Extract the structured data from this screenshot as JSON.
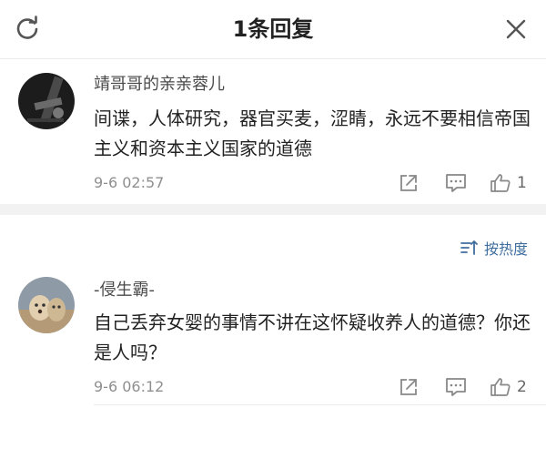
{
  "header": {
    "title": "1条回复",
    "refresh_icon": "refresh-icon",
    "close_icon": "close-icon"
  },
  "sort": {
    "label": "按热度",
    "icon": "sort-icon"
  },
  "comments": [
    {
      "username": "靖哥哥的亲亲蓉儿",
      "text": "间谍，人体研究，器官买麦，涩睛，永远不要相信帝国主义和资本主义国家的道德",
      "time": "9-6 02:57",
      "likes": "1"
    },
    {
      "username": "-侵生霸-",
      "text": "自己丢弃女婴的事情不讲在这怀疑收养人的道德？你还是人吗？",
      "time": "9-6 06:12",
      "likes": "2"
    }
  ],
  "colors": {
    "accent": "#3f6e9e",
    "divider": "#f2f2f2",
    "meta_text": "#8f8f8f"
  }
}
